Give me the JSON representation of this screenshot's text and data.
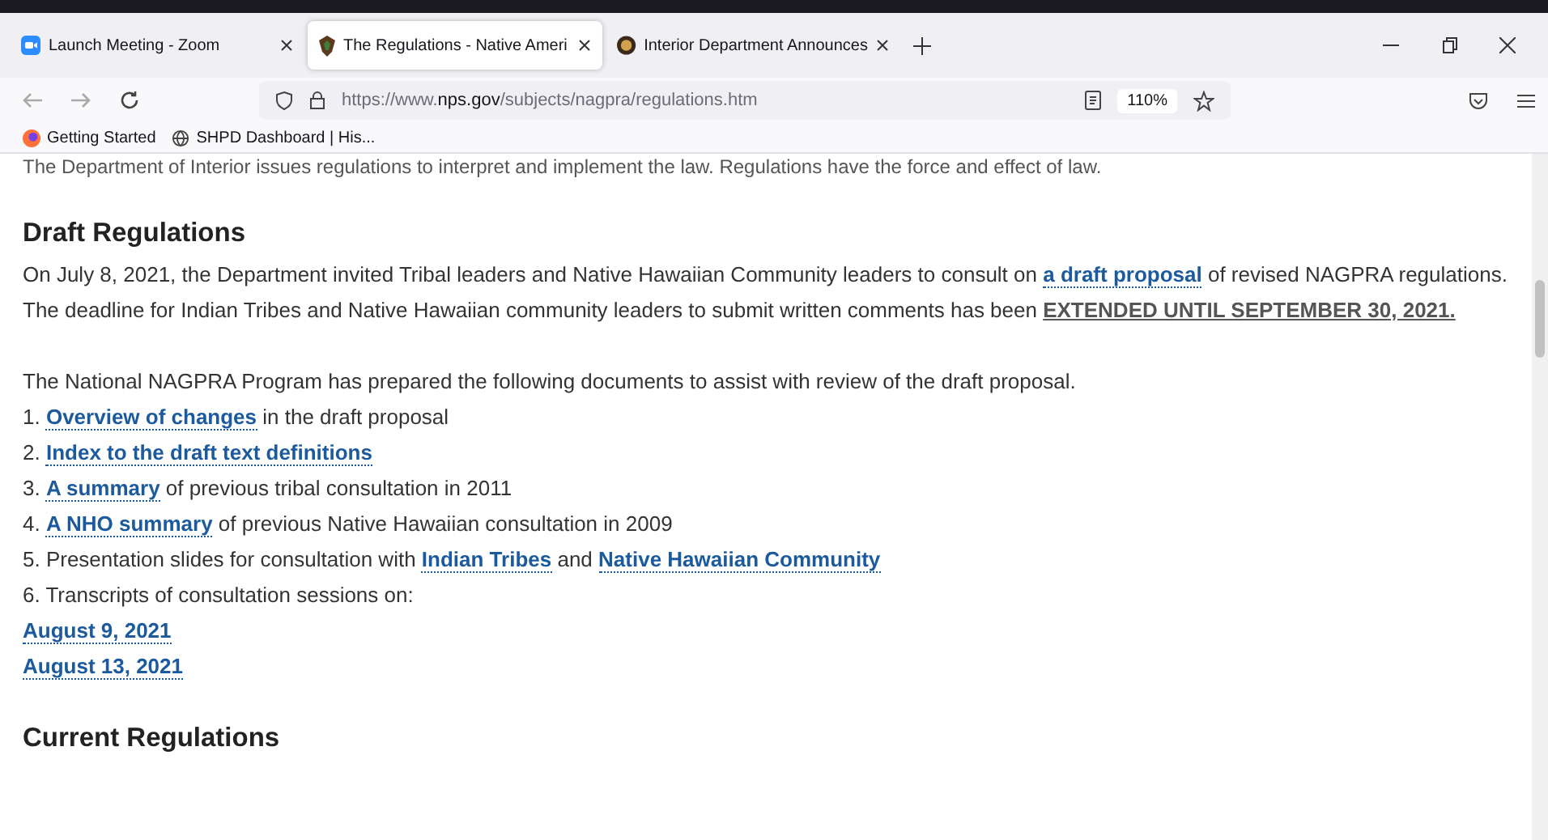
{
  "tabs": [
    {
      "title": "Launch Meeting - Zoom",
      "selected": false
    },
    {
      "title": "The Regulations - Native Ameri",
      "selected": true
    },
    {
      "title": "Interior Department Announces",
      "selected": false
    }
  ],
  "address": {
    "prefix": "https://www.",
    "domain": "nps.gov",
    "path": "/subjects/nagpra/regulations.htm",
    "zoom": "110%"
  },
  "bookmarks": [
    {
      "label": "Getting Started"
    },
    {
      "label": "SHPD Dashboard | His..."
    }
  ],
  "page": {
    "intro": "The Department of Interior issues regulations to interpret and implement the law. Regulations have the force and effect of law.",
    "sections": [
      {
        "heading": "Draft Regulations",
        "blocks": [
          {
            "kind": "paragraph",
            "segments": [
              {
                "kind": "text",
                "text": "On July 8, 2021, the Department invited Tribal leaders and Native Hawaiian Community leaders to consult on "
              },
              {
                "kind": "link",
                "text": "a draft proposal"
              },
              {
                "kind": "text",
                "text": " of revised NAGPRA regulations. The deadline for Indian Tribes and Native Hawaiian community leaders to submit written comments has been "
              },
              {
                "kind": "emphasis",
                "text": "EXTENDED UNTIL SEPTEMBER 30, 2021."
              }
            ]
          },
          {
            "kind": "gap"
          },
          {
            "kind": "line",
            "segments": [
              {
                "kind": "text",
                "text": "The National NAGPRA Program has prepared the following documents to assist with review of the draft proposal."
              }
            ]
          },
          {
            "kind": "line",
            "segments": [
              {
                "kind": "text",
                "text": "1. "
              },
              {
                "kind": "link",
                "text": "Overview of changes"
              },
              {
                "kind": "text",
                "text": " in the draft proposal"
              }
            ]
          },
          {
            "kind": "line",
            "segments": [
              {
                "kind": "text",
                "text": "2. "
              },
              {
                "kind": "link",
                "text": "Index to the draft text definitions"
              }
            ]
          },
          {
            "kind": "line",
            "segments": [
              {
                "kind": "text",
                "text": "3. "
              },
              {
                "kind": "link",
                "text": "A summary"
              },
              {
                "kind": "text",
                "text": " of previous tribal consultation in 2011"
              }
            ]
          },
          {
            "kind": "line",
            "segments": [
              {
                "kind": "text",
                "text": "4. "
              },
              {
                "kind": "link",
                "text": "A NHO summary"
              },
              {
                "kind": "text",
                "text": " of previous Native Hawaiian consultation in 2009"
              }
            ]
          },
          {
            "kind": "line",
            "segments": [
              {
                "kind": "text",
                "text": "5. Presentation slides for consultation with "
              },
              {
                "kind": "link",
                "text": "Indian Tribes"
              },
              {
                "kind": "text",
                "text": " and "
              },
              {
                "kind": "link",
                "text": "Native Hawaiian Community"
              }
            ]
          },
          {
            "kind": "line",
            "segments": [
              {
                "kind": "text",
                "text": "6. Transcripts of consultation sessions on:"
              }
            ]
          },
          {
            "kind": "line",
            "segments": [
              {
                "kind": "link",
                "text": "August 9, 2021"
              }
            ]
          },
          {
            "kind": "line",
            "segments": [
              {
                "kind": "link",
                "text": "August 13, 2021"
              }
            ]
          }
        ]
      },
      {
        "heading": "Current Regulations"
      }
    ]
  }
}
